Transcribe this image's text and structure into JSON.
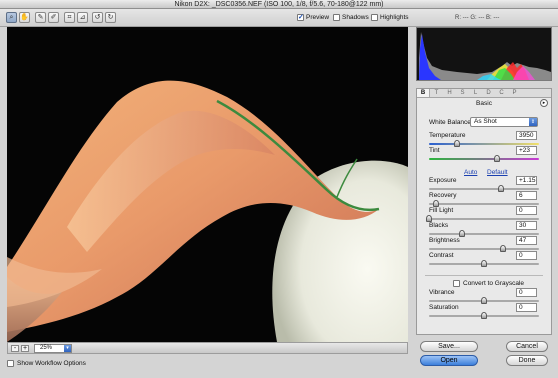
{
  "window": {
    "title": "Nikon D2X:  _DSC0356.NEF  (ISO 100, 1/8, f/5.6, 70-180@122 mm)"
  },
  "toolbar": {
    "tools": [
      {
        "name": "zoom-tool-icon",
        "glyph": "⌕"
      },
      {
        "name": "hand-tool-icon",
        "glyph": "✋"
      },
      {
        "name": "white-balance-tool-icon",
        "glyph": "✎"
      },
      {
        "name": "color-sampler-tool-icon",
        "glyph": "✐"
      },
      {
        "name": "crop-tool-icon",
        "glyph": "⌗"
      },
      {
        "name": "straighten-tool-icon",
        "glyph": "⊿"
      },
      {
        "name": "rotate-left-icon",
        "glyph": "↺"
      },
      {
        "name": "rotate-right-icon",
        "glyph": "↻"
      }
    ],
    "preview_label": "Preview",
    "shadows_label": "Shadows",
    "highlights_label": "Highlights",
    "preview_checked": true,
    "shadows_checked": false,
    "highlights_checked": false,
    "rgb_readout": "R: ---   G: ---   B: ---"
  },
  "status": {
    "zoom_value": "25%",
    "zoom_out_glyph": "-",
    "zoom_in_glyph": "+",
    "dropdown_glyph": "▾"
  },
  "workflow": {
    "label": "Show Workflow Options"
  },
  "panel": {
    "tabs": [
      "B",
      "T",
      "H",
      "S",
      "L",
      "D",
      "C",
      "P"
    ],
    "active_tab": 0,
    "title": "Basic",
    "menu_glyph": "▸",
    "white_balance": {
      "label": "White Balance:",
      "value": "As Shot",
      "arrow_glyph": "⇕"
    },
    "sliders": [
      {
        "label": "Temperature",
        "value": "3950",
        "position": 0.25,
        "style": "temp"
      },
      {
        "label": "Tint",
        "value": "+23",
        "position": 0.62,
        "style": "tint"
      },
      {
        "label": "Exposure",
        "value": "+1.15",
        "position": 0.65,
        "style": "plain"
      },
      {
        "label": "Recovery",
        "value": "6",
        "position": 0.06,
        "style": "plain"
      },
      {
        "label": "Fill Light",
        "value": "0",
        "position": 0.0,
        "style": "plain"
      },
      {
        "label": "Blacks",
        "value": "30",
        "position": 0.3,
        "style": "plain"
      },
      {
        "label": "Brightness",
        "value": "47",
        "position": 0.67,
        "style": "plain"
      },
      {
        "label": "Contrast",
        "value": "0",
        "position": 0.5,
        "style": "plain"
      },
      {
        "label": "Vibrance",
        "value": "0",
        "position": 0.5,
        "style": "plain"
      },
      {
        "label": "Saturation",
        "value": "0",
        "position": 0.5,
        "style": "plain"
      }
    ],
    "auto_label": "Auto",
    "default_label": "Default",
    "grayscale_label": "Convert to Grayscale"
  },
  "buttons": {
    "save": "Save...",
    "cancel": "Cancel",
    "open": "Open",
    "done": "Done"
  },
  "colors": {
    "accent": "#3c7fdb",
    "preview_background": "#000000"
  }
}
